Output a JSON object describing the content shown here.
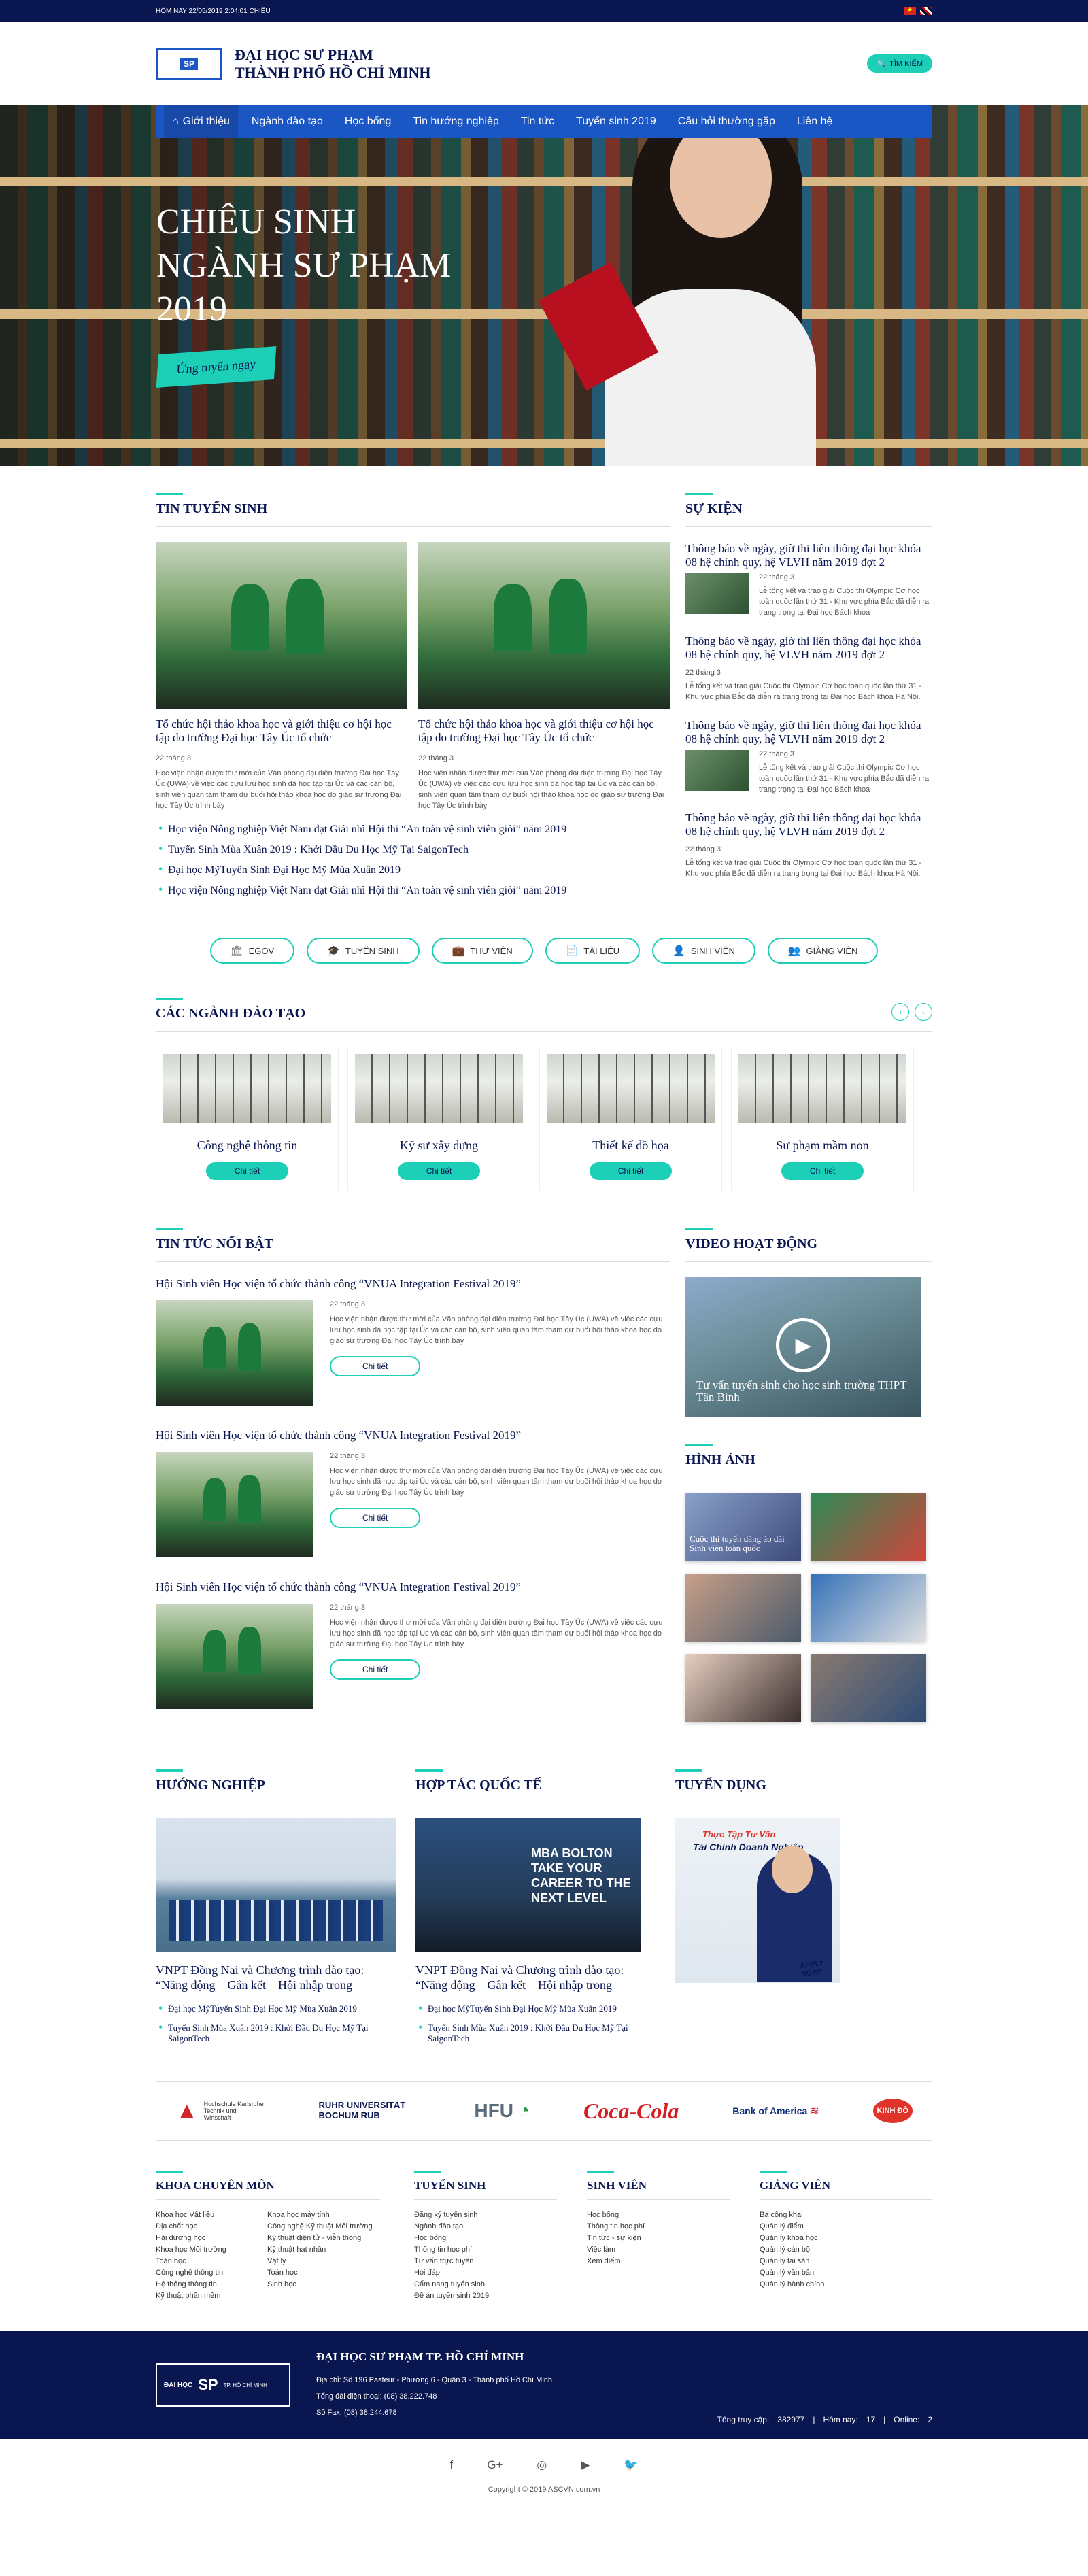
{
  "topbar": {
    "date": "HÔM NAY 22/05/2019 2:04:01 CHIỀU"
  },
  "header": {
    "logo_abbr": "SP",
    "title_line1": "ĐẠI HỌC SƯ PHẠM",
    "title_line2": "THÀNH PHỐ HỒ CHÍ MINH",
    "search_label": "TÌM KIẾM"
  },
  "nav": {
    "items": [
      "Giới thiệu",
      "Ngành đào tạo",
      "Học bổng",
      "Tin hướng nghiệp",
      "Tin tức",
      "Tuyển sinh 2019",
      "Câu hỏi thường gặp",
      "Liên hệ"
    ]
  },
  "hero": {
    "title_line1": "CHIÊU SINH",
    "title_line2": "NGÀNH SƯ PHẠM",
    "title_line3": "2019",
    "button": "Ứng tuyển ngay"
  },
  "admissions": {
    "title": "TIN TUYỂN SINH",
    "articles": [
      {
        "title": "Tổ chức hội thảo khoa học và giới thiệu cơ hội học tập do trường Đại học Tây Úc tổ chức",
        "date": "22 tháng 3",
        "desc": "Học viện nhận được thư mời của Văn phòng đại diện trường Đại học Tây Úc (UWA) về việc các cựu lưu học sinh đã học tập tại Úc và các cán bộ, sinh viên quan tâm tham dự buổi hội thảo khoa học do giáo sư trường Đại học Tây Úc trình bày"
      },
      {
        "title": "Tổ chức hội thảo khoa học và giới thiệu cơ hội học tập do trường Đại học Tây Úc tổ chức",
        "date": "22 tháng 3",
        "desc": "Học viện nhận được thư mời của Văn phòng đại diện trường Đại học Tây Úc (UWA) về việc các cựu lưu học sinh đã học tập tại Úc và các cán bộ, sinh viên quan tâm tham dự buổi hội thảo khoa học do giáo sư trường Đại học Tây Úc trình bày"
      }
    ],
    "links": [
      "Học viện Nông nghiệp Việt Nam đạt Giải nhì Hội thi “An toàn vệ sinh viên giỏi” năm 2019",
      "Tuyển Sinh Mùa Xuân 2019 : Khởi Đầu Du Học Mỹ Tại SaigonTech",
      "Đại học MỹTuyển Sinh Đại Học Mỹ Mùa Xuân 2019",
      "Học viện Nông nghiệp Việt Nam đạt Giải nhì Hội thi “An toàn vệ sinh viên giỏi” năm 2019"
    ]
  },
  "events": {
    "title": "SỰ KIỆN",
    "items": [
      {
        "title": "Thông báo về ngày, giờ thi liên thông đại học khóa 08 hệ chính quy, hệ VLVH năm 2019 đợt 2",
        "date": "22 tháng 3",
        "desc": "Lễ tổng kết và trao giải Cuộc thi Olympic Cơ học toàn quốc lần thứ 31 - Khu vực phía Bắc đã diễn ra trang trọng tại Đại học Bách khoa"
      },
      {
        "title": "Thông báo về ngày, giờ thi liên thông đại học khóa 08 hệ chính quy, hệ VLVH năm 2019 đợt 2",
        "date": "22 tháng 3",
        "desc": "Lễ tổng kết và trao giải Cuộc thi Olympic Cơ học toàn quốc lần thứ 31 - Khu vực phía Bắc đã diễn ra trang trọng tại Đại học Bách khoa Hà Nội."
      },
      {
        "title": "Thông báo về ngày, giờ thi liên thông đại học khóa 08 hệ chính quy, hệ VLVH năm 2019 đợt 2",
        "date": "22 tháng 3",
        "desc": "Lễ tổng kết và trao giải Cuộc thi Olympic Cơ học toàn quốc lần thứ 31 - Khu vực phía Bắc đã diễn ra trang trọng tại Đại học Bách khoa"
      },
      {
        "title": "Thông báo về ngày, giờ thi liên thông đại học khóa 08 hệ chính quy, hệ VLVH năm 2019 đợt 2",
        "date": "22 tháng 3",
        "desc": "Lễ tổng kết và trao giải Cuộc thi Olympic Cơ học toàn quốc lần thứ 31 - Khu vực phía Bắc đã diễn ra trang trọng tại Đại học Bách khoa Hà Nội."
      }
    ]
  },
  "quicklinks": [
    {
      "label": "EGOV",
      "icon": "bank-icon",
      "glyph": "🏛"
    },
    {
      "label": "TUYỂN SINH",
      "icon": "graduation-cap-icon",
      "glyph": "🎓"
    },
    {
      "label": "THƯ VIỆN",
      "icon": "briefcase-icon",
      "glyph": "💼"
    },
    {
      "label": "TÀI LIỆU",
      "icon": "document-icon",
      "glyph": "📄"
    },
    {
      "label": "SINH VIÊN",
      "icon": "student-icon",
      "glyph": "👤"
    },
    {
      "label": "GIẢNG VIÊN",
      "icon": "teacher-icon",
      "glyph": "👥"
    }
  ],
  "programs": {
    "title": "CÁC NGÀNH ĐÀO TẠO",
    "detail_label": "Chi tiết",
    "items": [
      "Công nghệ thông tin",
      "Kỹ sư xây dựng",
      "Thiết kế đồ họa",
      "Sư phạm mầm non"
    ]
  },
  "featured": {
    "title": "TIN TỨC NỔI BẬT",
    "detail_label": "Chi tiết",
    "items": [
      {
        "title": "Hội Sinh viên Học viện tổ chức thành công “VNUA Integration Festival 2019”",
        "date": "22 tháng 3",
        "desc": "Học viện nhận được thư mời của Văn phòng đại diện trường Đại học Tây Úc (UWA) về việc các cựu lưu học sinh đã học tập tại Úc và các cán bộ, sinh viên quan tâm tham dự buổi hội thảo khoa học do giáo sư trường Đại học Tây Úc trình bày"
      },
      {
        "title": "Hội Sinh viên Học viện tổ chức thành công “VNUA Integration Festival 2019”",
        "date": "22 tháng 3",
        "desc": "Học viện nhận được thư mời của Văn phòng đại diện trường Đại học Tây Úc (UWA) về việc các cựu lưu học sinh đã học tập tại Úc và các cán bộ, sinh viên quan tâm tham dự buổi hội thảo khoa học do giáo sư trường Đại học Tây Úc trình bày"
      },
      {
        "title": "Hội Sinh viên Học viện tổ chức thành công “VNUA Integration Festival 2019”",
        "date": "22 tháng 3",
        "desc": "Học viện nhận được thư mời của Văn phòng đại diện trường Đại học Tây Úc (UWA) về việc các cựu lưu học sinh đã học tập tại Úc và các cán bộ, sinh viên quan tâm tham dự buổi hội thảo khoa học do giáo sư trường Đại học Tây Úc trình bày"
      }
    ]
  },
  "video": {
    "title": "VIDEO HOẠT ĐỘNG",
    "caption": "Tư vấn tuyển sinh cho học sinh trường THPT Tân Bình"
  },
  "gallery": {
    "title": "HÌNH ẢNH",
    "caption": "Cuộc thi tuyển dàng áo dài Sinh viên toàn quốc"
  },
  "career": {
    "title": "HƯỚNG NGHIỆP",
    "headline": "VNPT Đồng Nai và Chương trình đào tạo: “Năng động – Gắn kết – Hội nhập trong",
    "links": [
      "Đại học MỹTuyển Sinh Đại Học Mỹ Mùa Xuân 2019",
      "Tuyển Sinh Mùa Xuân 2019 : Khởi Đầu Du Học Mỹ Tại SaigonTech"
    ]
  },
  "cooperation": {
    "title": "HỢP TÁC QUỐC TẾ",
    "image_text": "MBA BOLTON TAKE YOUR CAREER TO THE NEXT LEVEL",
    "headline": "VNPT Đồng Nai và Chương trình đào tạo: “Năng động – Gắn kết – Hội nhập trong",
    "links": [
      "Đại học MỹTuyển Sinh Đại Học Mỹ Mùa Xuân 2019",
      "Tuyển Sinh Mùa Xuân 2019 : Khởi Đầu Du Học Mỹ Tại SaigonTech"
    ]
  },
  "recruitment": {
    "title": "TUYỂN DỤNG",
    "banner_line1": "Thực Tập Tư Vấn",
    "banner_line2": "Tài Chính Doanh Nghiệp",
    "apply": "APPLY NGAY"
  },
  "partners": [
    "Hochschule Karlsruhe Technik und Wirtschaft",
    "RUHR UNIVERSITÄT BOCHUM RUB",
    "HFU",
    "Coca-Cola",
    "Bank of America",
    "KINH ĐÔ"
  ],
  "footer_cols": [
    {
      "title": "KHOA CHUYÊN MÔN",
      "col1": [
        "Khoa học Vật liệu",
        "Địa chất học",
        "Hải dương học",
        "Khoa học Môi trường",
        "Toán học",
        "Công nghệ thông tin",
        "Hệ thống thông tin",
        "Kỹ thuật phần mềm"
      ],
      "col2": [
        "Khoa học máy tính",
        "Công nghệ Kỹ thuật Môi trường",
        "Kỹ thuật điện tử - viễn thông",
        "Kỹ thuật hạt nhân",
        "Vật lý",
        "Toán học",
        "Sinh học"
      ]
    },
    {
      "title": "TUYỂN SINH",
      "items": [
        "Đăng ký tuyển sinh",
        "Ngành đào tạo",
        "Học bổng",
        "Thông tin học phí",
        "Tư vấn trực tuyến",
        "Hỏi đáp",
        "Cẩm nang tuyển sinh",
        "Đề án tuyển sinh 2019"
      ]
    },
    {
      "title": "SINH VIÊN",
      "items": [
        "Học bổng",
        "Thông tin học phí",
        "Tin tức - sự kiện",
        "Việc làm",
        "Xem điểm"
      ]
    },
    {
      "title": "GIẢNG VIÊN",
      "items": [
        "Ba công khai",
        "Quản lý điểm",
        "Quản lý khoa học",
        "Quản lý cán bộ",
        "Quản lý tài sản",
        "Quản lý văn bản",
        "Quản lý hành chính"
      ]
    }
  ],
  "bottom": {
    "logo_line1": "ĐẠI HỌC",
    "logo_abbr": "SP",
    "logo_line2": "TP. HỒ CHÍ MINH",
    "name": "ĐẠI HỌC SƯ PHẠM TP. HỒ CHÍ MINH",
    "address": "Địa chỉ: Số 196 Pasteur - Phường 6 - Quận 3 - Thành phố Hồ Chí Minh",
    "phone": "Tổng đài điện thoại: (08) 38.222.748",
    "fax": "Số Fax: (08) 38.244.678",
    "total_label": "Tổng truy cập:",
    "total_value": "382977",
    "today_label": "Hôm nay:",
    "today_value": "17",
    "online_label": "Online:",
    "online_value": "2"
  },
  "social": [
    {
      "icon": "facebook-icon",
      "glyph": "f"
    },
    {
      "icon": "google-plus-icon",
      "glyph": "G+"
    },
    {
      "icon": "instagram-icon",
      "glyph": "◎"
    },
    {
      "icon": "youtube-icon",
      "glyph": "▶"
    },
    {
      "icon": "twitter-icon",
      "glyph": "🐦"
    }
  ],
  "copyright": "Copyright © 2019 ASCVN.com.vn"
}
